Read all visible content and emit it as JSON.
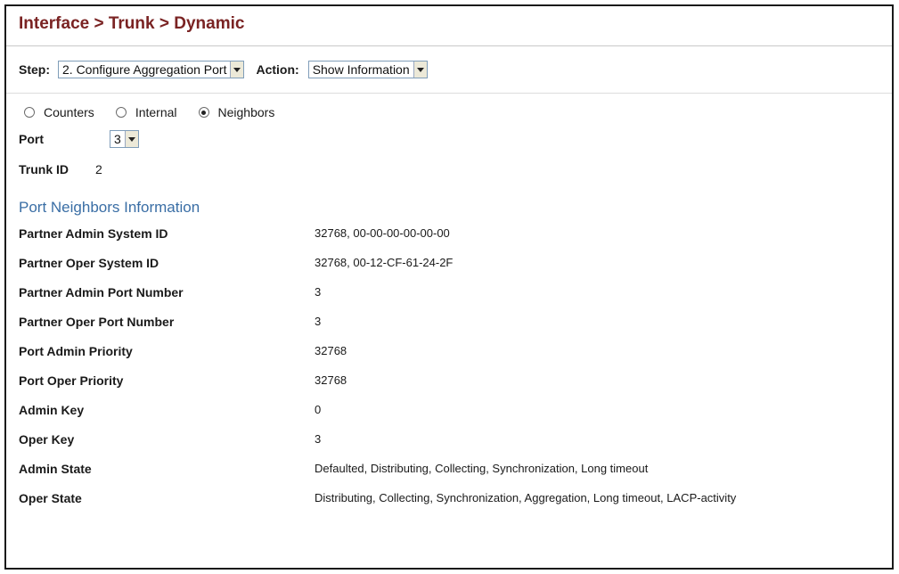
{
  "header": {
    "breadcrumb": "Interface > Trunk > Dynamic"
  },
  "toolbar": {
    "step_label": "Step:",
    "step_value": "2. Configure Aggregation Port",
    "action_label": "Action:",
    "action_value": "Show Information"
  },
  "view_options": [
    {
      "label": "Counters",
      "selected": false
    },
    {
      "label": "Internal",
      "selected": false
    },
    {
      "label": "Neighbors",
      "selected": true
    }
  ],
  "port": {
    "label": "Port",
    "value": "3"
  },
  "trunk": {
    "label": "Trunk ID",
    "value": "2"
  },
  "section": {
    "title": "Port Neighbors Information"
  },
  "rows": [
    {
      "key": "Partner Admin System ID",
      "value": "32768, 00-00-00-00-00-00"
    },
    {
      "key": "Partner Oper System ID",
      "value": "32768, 00-12-CF-61-24-2F"
    },
    {
      "key": "Partner Admin Port Number",
      "value": "3"
    },
    {
      "key": "Partner Oper Port Number",
      "value": "3"
    },
    {
      "key": "Port Admin Priority",
      "value": "32768"
    },
    {
      "key": "Port Oper Priority",
      "value": "32768"
    },
    {
      "key": "Admin Key",
      "value": "0"
    },
    {
      "key": "Oper Key",
      "value": "3"
    },
    {
      "key": "Admin State",
      "value": "Defaulted, Distributing, Collecting, Synchronization, Long timeout"
    },
    {
      "key": "Oper State",
      "value": "Distributing, Collecting, Synchronization, Aggregation, Long timeout, LACP-activity"
    }
  ]
}
